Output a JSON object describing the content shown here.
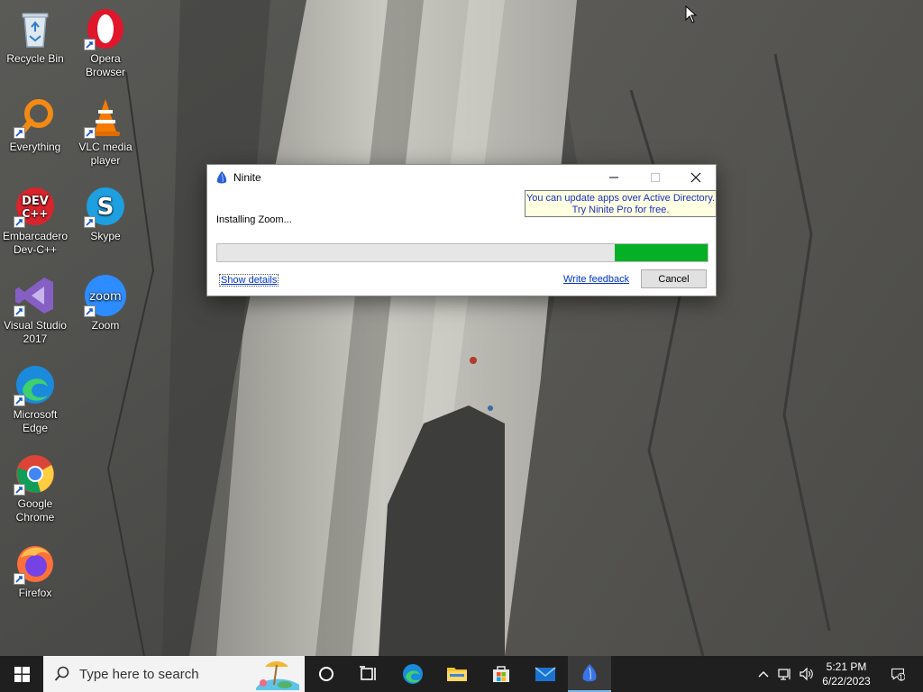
{
  "desktop": {
    "icons": [
      {
        "id": "recycle-bin",
        "label": "Recycle Bin"
      },
      {
        "id": "opera",
        "label": "Opera Browser"
      },
      {
        "id": "everything",
        "label": "Everything"
      },
      {
        "id": "vlc",
        "label": "VLC media player"
      },
      {
        "id": "devcpp",
        "label": "Embarcadero Dev-C++"
      },
      {
        "id": "skype",
        "label": "Skype"
      },
      {
        "id": "vs2017",
        "label": "Visual Studio 2017"
      },
      {
        "id": "zoom",
        "label": "Zoom"
      },
      {
        "id": "edge",
        "label": "Microsoft Edge"
      },
      {
        "id": "chrome",
        "label": "Google Chrome"
      },
      {
        "id": "firefox",
        "label": "Firefox"
      }
    ]
  },
  "ninite": {
    "title": "Ninite",
    "promo_line1": "You can update apps over Active Directory.",
    "promo_line2": "Try Ninite Pro for free.",
    "status": "Installing Zoom...",
    "progress_fraction": 0.19,
    "progress_start_fraction": 0.81,
    "show_details": "Show details",
    "write_feedback": "Write feedback",
    "cancel": "Cancel",
    "progress_color": "#06b025"
  },
  "taskbar": {
    "search_placeholder": "Type here to search",
    "apps": [
      "task-view",
      "edge",
      "file-explorer",
      "microsoft-store",
      "mail",
      "ninite"
    ],
    "clock_time": "5:21 PM",
    "clock_date": "6/22/2023",
    "notification_count": "1",
    "accent": "#76b9ed"
  }
}
